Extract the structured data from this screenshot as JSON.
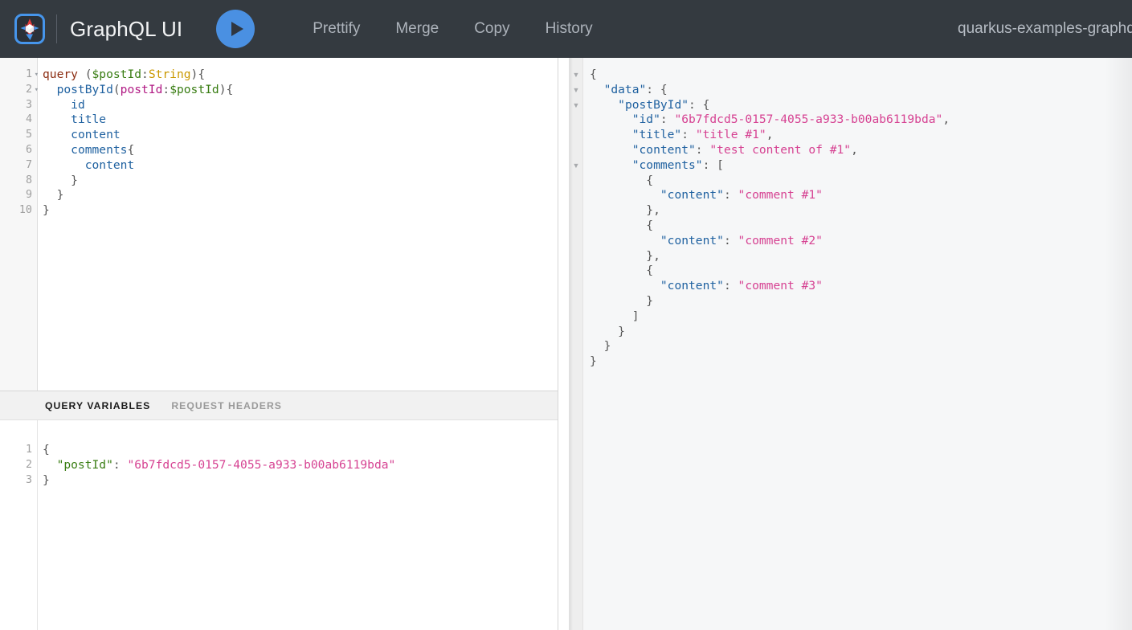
{
  "header": {
    "logo_icon": "quarkus-logo-icon",
    "title": "GraphQL UI",
    "execute_icon": "play-icon",
    "nav": [
      {
        "label": "Prettify",
        "name": "prettify"
      },
      {
        "label": "Merge",
        "name": "merge"
      },
      {
        "label": "Copy",
        "name": "copy"
      },
      {
        "label": "History",
        "name": "history"
      }
    ],
    "endpoint": "quarkus-examples-graphql"
  },
  "query_editor": {
    "line_numbers": [
      "1",
      "2",
      "3",
      "4",
      "5",
      "6",
      "7",
      "8",
      "9",
      "10"
    ],
    "fold_lines": [
      1,
      2
    ],
    "fold_glyph": "▾",
    "lines": [
      [
        {
          "t": "query",
          "c": "t-kw"
        },
        {
          "t": " (",
          "c": "t-punc"
        },
        {
          "t": "$postId",
          "c": "t-var"
        },
        {
          "t": ":",
          "c": "t-punc"
        },
        {
          "t": "String",
          "c": "t-type"
        },
        {
          "t": "){",
          "c": "t-punc"
        }
      ],
      [
        {
          "t": "  ",
          "c": "t-punc"
        },
        {
          "t": "postById",
          "c": "t-field"
        },
        {
          "t": "(",
          "c": "t-punc"
        },
        {
          "t": "postId",
          "c": "t-arg"
        },
        {
          "t": ":",
          "c": "t-punc"
        },
        {
          "t": "$postId",
          "c": "t-var"
        },
        {
          "t": "){",
          "c": "t-punc"
        }
      ],
      [
        {
          "t": "    ",
          "c": "t-punc"
        },
        {
          "t": "id",
          "c": "t-field"
        }
      ],
      [
        {
          "t": "    ",
          "c": "t-punc"
        },
        {
          "t": "title",
          "c": "t-field"
        }
      ],
      [
        {
          "t": "    ",
          "c": "t-punc"
        },
        {
          "t": "content",
          "c": "t-field"
        }
      ],
      [
        {
          "t": "    ",
          "c": "t-punc"
        },
        {
          "t": "comments",
          "c": "t-field"
        },
        {
          "t": "{",
          "c": "t-punc"
        }
      ],
      [
        {
          "t": "      ",
          "c": "t-punc"
        },
        {
          "t": "content",
          "c": "t-field"
        }
      ],
      [
        {
          "t": "    }",
          "c": "t-punc"
        }
      ],
      [
        {
          "t": "  }",
          "c": "t-punc"
        }
      ],
      [
        {
          "t": "}",
          "c": "t-punc"
        }
      ]
    ]
  },
  "variables_panel": {
    "tabs": [
      {
        "label": "QUERY VARIABLES",
        "name": "query-variables",
        "active": true
      },
      {
        "label": "REQUEST HEADERS",
        "name": "request-headers",
        "active": false
      }
    ],
    "line_numbers": [
      "1",
      "2",
      "3"
    ],
    "lines": [
      [
        {
          "t": "{",
          "c": "r-punc"
        }
      ],
      [
        {
          "t": "  ",
          "c": "r-punc"
        },
        {
          "t": "\"postId\"",
          "c": "v-key"
        },
        {
          "t": ": ",
          "c": "r-punc"
        },
        {
          "t": "\"6b7fdcd5-0157-4055-a933-b00ab6119bda\"",
          "c": "v-str"
        }
      ],
      [
        {
          "t": "}",
          "c": "r-punc"
        }
      ]
    ]
  },
  "result_panel": {
    "fold_lines": [
      1,
      2,
      3,
      7
    ],
    "fold_glyph": "▼",
    "total_lines": 21,
    "lines": [
      [
        {
          "t": "{",
          "c": "r-punc"
        }
      ],
      [
        {
          "t": "  ",
          "c": "r-punc"
        },
        {
          "t": "\"data\"",
          "c": "r-key"
        },
        {
          "t": ": {",
          "c": "r-punc"
        }
      ],
      [
        {
          "t": "    ",
          "c": "r-punc"
        },
        {
          "t": "\"postById\"",
          "c": "r-key"
        },
        {
          "t": ": {",
          "c": "r-punc"
        }
      ],
      [
        {
          "t": "      ",
          "c": "r-punc"
        },
        {
          "t": "\"id\"",
          "c": "r-key"
        },
        {
          "t": ": ",
          "c": "r-punc"
        },
        {
          "t": "\"6b7fdcd5-0157-4055-a933-b00ab6119bda\"",
          "c": "r-str"
        },
        {
          "t": ",",
          "c": "r-punc"
        }
      ],
      [
        {
          "t": "      ",
          "c": "r-punc"
        },
        {
          "t": "\"title\"",
          "c": "r-key"
        },
        {
          "t": ": ",
          "c": "r-punc"
        },
        {
          "t": "\"title #1\"",
          "c": "r-str"
        },
        {
          "t": ",",
          "c": "r-punc"
        }
      ],
      [
        {
          "t": "      ",
          "c": "r-punc"
        },
        {
          "t": "\"content\"",
          "c": "r-key"
        },
        {
          "t": ": ",
          "c": "r-punc"
        },
        {
          "t": "\"test content of #1\"",
          "c": "r-str"
        },
        {
          "t": ",",
          "c": "r-punc"
        }
      ],
      [
        {
          "t": "      ",
          "c": "r-punc"
        },
        {
          "t": "\"comments\"",
          "c": "r-key"
        },
        {
          "t": ": [",
          "c": "r-punc"
        }
      ],
      [
        {
          "t": "        {",
          "c": "r-punc"
        }
      ],
      [
        {
          "t": "          ",
          "c": "r-punc"
        },
        {
          "t": "\"content\"",
          "c": "r-key"
        },
        {
          "t": ": ",
          "c": "r-punc"
        },
        {
          "t": "\"comment #1\"",
          "c": "r-str"
        }
      ],
      [
        {
          "t": "        },",
          "c": "r-punc"
        }
      ],
      [
        {
          "t": "        {",
          "c": "r-punc"
        }
      ],
      [
        {
          "t": "          ",
          "c": "r-punc"
        },
        {
          "t": "\"content\"",
          "c": "r-key"
        },
        {
          "t": ": ",
          "c": "r-punc"
        },
        {
          "t": "\"comment #2\"",
          "c": "r-str"
        }
      ],
      [
        {
          "t": "        },",
          "c": "r-punc"
        }
      ],
      [
        {
          "t": "        {",
          "c": "r-punc"
        }
      ],
      [
        {
          "t": "          ",
          "c": "r-punc"
        },
        {
          "t": "\"content\"",
          "c": "r-key"
        },
        {
          "t": ": ",
          "c": "r-punc"
        },
        {
          "t": "\"comment #3\"",
          "c": "r-str"
        }
      ],
      [
        {
          "t": "        }",
          "c": "r-punc"
        }
      ],
      [
        {
          "t": "      ]",
          "c": "r-punc"
        }
      ],
      [
        {
          "t": "    }",
          "c": "r-punc"
        }
      ],
      [
        {
          "t": "  }",
          "c": "r-punc"
        }
      ],
      [
        {
          "t": "}",
          "c": "r-punc"
        }
      ]
    ]
  },
  "colors": {
    "topbar_bg": "#343a40",
    "accent_blue": "#4a90e2",
    "result_bg": "#f6f7f8",
    "gutter_bg": "#f7f7f7",
    "string_pink": "#d64292",
    "key_blue": "#1f61a0"
  }
}
